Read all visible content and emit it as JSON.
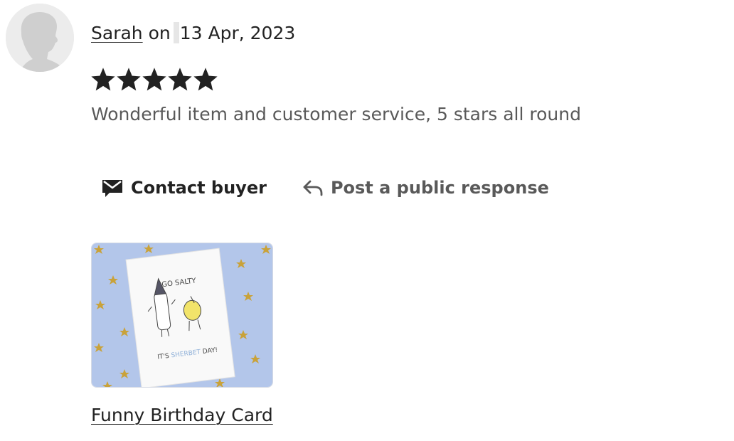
{
  "review": {
    "reviewer_name": "Sarah",
    "on_label": "on",
    "date": "13 Apr, 2023",
    "rating": 5,
    "rating_max": 5,
    "text": "Wonderful item and customer service, 5 stars all round"
  },
  "actions": {
    "contact_label": "Contact buyer",
    "contact_icon": "envelope-icon",
    "respond_label": "Post a public response",
    "respond_icon": "reply-arrow-icon"
  },
  "product": {
    "name": "Funny Birthday Card",
    "image_text_top": "GO SALTY",
    "image_text_bottom_a": "IT'S",
    "image_text_bottom_b": "SHERBET",
    "image_text_bottom_c": "DAY!"
  },
  "colors": {
    "text_primary": "#222222",
    "text_secondary": "#595959",
    "star": "#222222",
    "product_bg": "#b3c6ea",
    "confetti": "#c9a23a"
  }
}
